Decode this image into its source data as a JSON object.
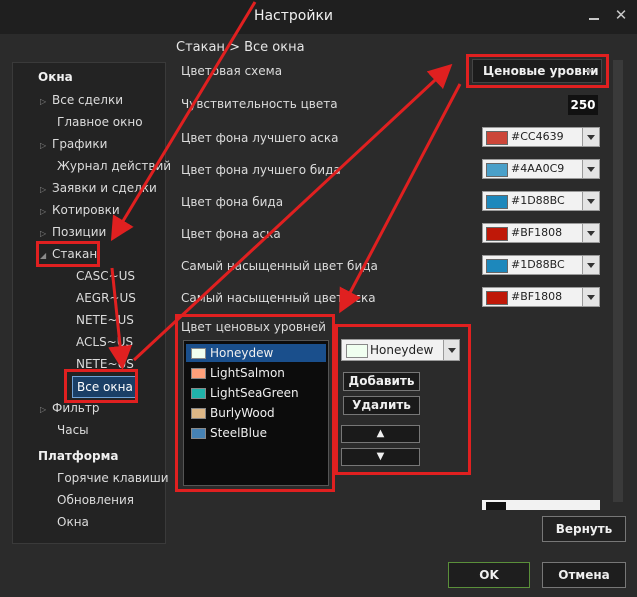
{
  "window": {
    "title": "Настройки",
    "close_glyph": "✕"
  },
  "breadcrumb": "Стакан > Все окна",
  "tree": {
    "groups": [
      {
        "label": "Окна"
      },
      {
        "label": "Платформа"
      }
    ],
    "items": [
      {
        "label": "Все сделки",
        "expandable": true
      },
      {
        "label": "Главное окно",
        "expandable": false
      },
      {
        "label": "Графики",
        "expandable": true
      },
      {
        "label": "Журнал действий",
        "expandable": false
      },
      {
        "label": "Заявки и сделки",
        "expandable": true
      },
      {
        "label": "Котировки",
        "expandable": true
      },
      {
        "label": "Позиции",
        "expandable": true
      },
      {
        "label": "Стакан",
        "expandable": true,
        "expanded": true
      },
      {
        "label": "CASC~US"
      },
      {
        "label": "AEGR~US"
      },
      {
        "label": "NETE~US"
      },
      {
        "label": "ACLS~US"
      },
      {
        "label": "NETE~US"
      },
      {
        "label": "Все окна",
        "selected": true
      },
      {
        "label": "Фильтр",
        "expandable": true
      },
      {
        "label": "Часы",
        "expandable": false
      }
    ],
    "platform_items": [
      {
        "label": "Горячие клавиши"
      },
      {
        "label": "Обновления"
      },
      {
        "label": "Окна"
      }
    ]
  },
  "settings": {
    "color_scheme": {
      "label": "Цветовая схема",
      "value": "Ценовые уровни"
    },
    "sensitivity": {
      "label": "Чувствительность цвета",
      "value": "250"
    },
    "rows": [
      {
        "label": "Цвет фона лучшего аска",
        "hex": "#CC4639",
        "color": "#CC4639"
      },
      {
        "label": "Цвет фона лучшего бида",
        "hex": "#4AA0C9",
        "color": "#4AA0C9"
      },
      {
        "label": "Цвет фона бида",
        "hex": "#1D88BC",
        "color": "#1D88BC"
      },
      {
        "label": "Цвет фона аска",
        "hex": "#BF1808",
        "color": "#BF1808"
      },
      {
        "label": "Самый насыщенный цвет бида",
        "hex": "#1D88BC",
        "color": "#1D88BC"
      },
      {
        "label": "Самый насыщенный цвет аска",
        "hex": "#BF1808",
        "color": "#BF1808"
      }
    ]
  },
  "price_levels": {
    "label": "Цвет ценовых уровней",
    "items": [
      {
        "name": "Honeydew",
        "color": "#F0FFF0",
        "selected": true
      },
      {
        "name": "LightSalmon",
        "color": "#FFA07A"
      },
      {
        "name": "LightSeaGreen",
        "color": "#20B2AA"
      },
      {
        "name": "BurlyWood",
        "color": "#DEB887"
      },
      {
        "name": "SteelBlue",
        "color": "#4682B4"
      }
    ],
    "color_picker": {
      "name": "Honeydew",
      "color": "#F0FFF0"
    },
    "add_label": "Добавить",
    "delete_label": "Удалить",
    "up_glyph": "▲",
    "down_glyph": "▼"
  },
  "buttons": {
    "reset": "Вернуть",
    "ok": "OK",
    "cancel": "Отмена"
  },
  "accent_colors": {
    "highlight": "#E02020",
    "selection": "#1A4F8C",
    "ok_border": "#5A8F3A"
  }
}
